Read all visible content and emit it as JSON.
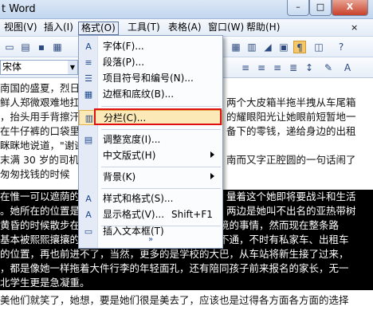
{
  "titlebar": {
    "title": "t Word",
    "min": "–",
    "max": "□",
    "close": "X"
  },
  "menubar": {
    "items": [
      "视图(V)",
      "插入(I)",
      "格式(O)",
      "工具(T)",
      "表格(A)",
      "窗口(W)",
      "帮助(H)"
    ],
    "extra": "×"
  },
  "toolbar2": {
    "font_name": "宋体"
  },
  "format_menu": {
    "items": [
      {
        "label": "字体(F)...",
        "icon": "font-icon"
      },
      {
        "label": "段落(P)...",
        "icon": "paragraph-icon"
      },
      {
        "label": "项目符号和编号(N)...",
        "icon": "bullets-icon"
      },
      {
        "label": "边框和底纹(B)...",
        "icon": "borders-icon"
      },
      {
        "label": "分栏(C)...",
        "icon": "columns-icon"
      },
      {
        "label": "调整宽度(I)...",
        "icon": "fit-width-icon"
      },
      {
        "label": "中文版式(H)",
        "icon": "none"
      },
      {
        "label": "背景(K)",
        "icon": "none"
      },
      {
        "label": "样式和格式(S)...",
        "icon": "styles-icon"
      },
      {
        "label": "显示格式(V)...",
        "shortcut": "Shift+F1",
        "icon": "reveal-format-icon"
      },
      {
        "label": "插入文本框(T)",
        "icon": "textbox-icon"
      }
    ],
    "more": "»"
  },
  "document": {
    "lines": [
      "南国的盛夏，烈日",
      "鲜人郑微艰难地扛了",
      "，抬头用手背擦汗",
      "在牛仔裤的口袋里",
      "眯眯地说道，\"谢谢",
      "末满 30 岁的司机",
      "匆匆找钱的时候",
      "在惟一可以遮荫的",
      "。她所在的位置是",
      "黄昏的时候散步在这样一条道路上应该是比较有意境的事情，然而现在整条路",
      "基本被熙熙攘攘的人和大大小小的桌子挤了个水泄不通，不时有私家车、出租车",
      "的位置，再也前进不了，当然，更多的是学校的大巴，从车站将新生接了过来，",
      "，都是像她一样拖着大件行李的年轻面孔，还有陪同孩子前来报名的家长，无一",
      "北学生更是急凝重。",
      "美他们就笑了，她想，要是她们很是美去了，应该也是过得各方面各方面的选择"
    ],
    "right_fragments": [
      "两个大皮箱半拖半拽从车尾箱",
      "的耀眼阳光让她眼前短暂地一",
      "备下的零钱，递给身边的出租",
      "",
      "南而又字正腔圆的一句话闹了",
      "",
      "量着这个她即将要战斗和生活",
      "两边是她叫不出名的亚热带树"
    ]
  },
  "colors": {
    "selection": "#000000",
    "highlight_box": "#e01010",
    "menu_hover": "#fbe9b7"
  }
}
